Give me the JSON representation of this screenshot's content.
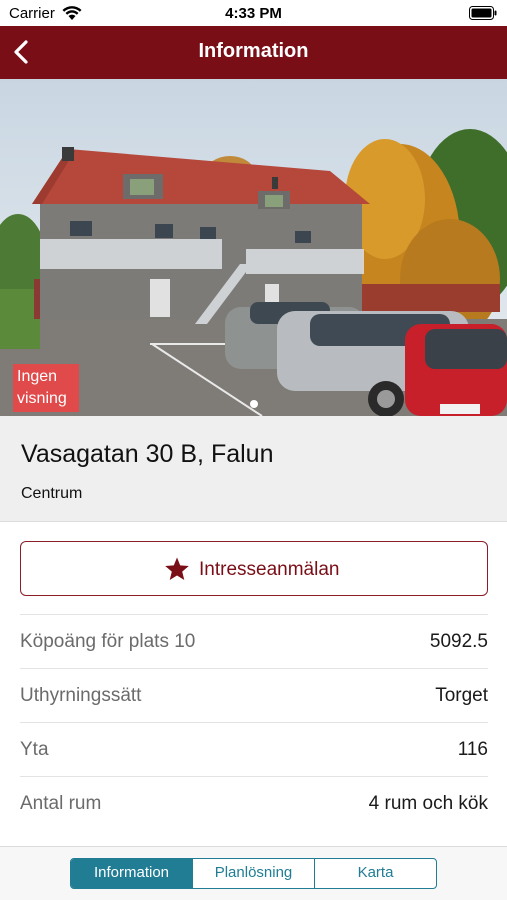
{
  "status_bar": {
    "carrier": "Carrier",
    "time": "4:33 PM"
  },
  "nav": {
    "title": "Information"
  },
  "photo": {
    "badge": "Ingen visning"
  },
  "listing": {
    "address": "Vasagatan 30 B, Falun",
    "area": "Centrum"
  },
  "actions": {
    "interest_label": "Intresseanmälan"
  },
  "details": [
    {
      "key": "Köpoäng för plats 10",
      "value": "5092.5"
    },
    {
      "key": "Uthyrningssätt",
      "value": "Torget"
    },
    {
      "key": "Yta",
      "value": "116"
    },
    {
      "key": "Antal rum",
      "value": "4 rum och kök"
    }
  ],
  "tabs": [
    {
      "label": "Information",
      "active": true
    },
    {
      "label": "Planlösning",
      "active": false
    },
    {
      "label": "Karta",
      "active": false
    }
  ],
  "colors": {
    "brand": "#7a0e17",
    "accent": "#207d94",
    "badge": "#e04a4a"
  }
}
